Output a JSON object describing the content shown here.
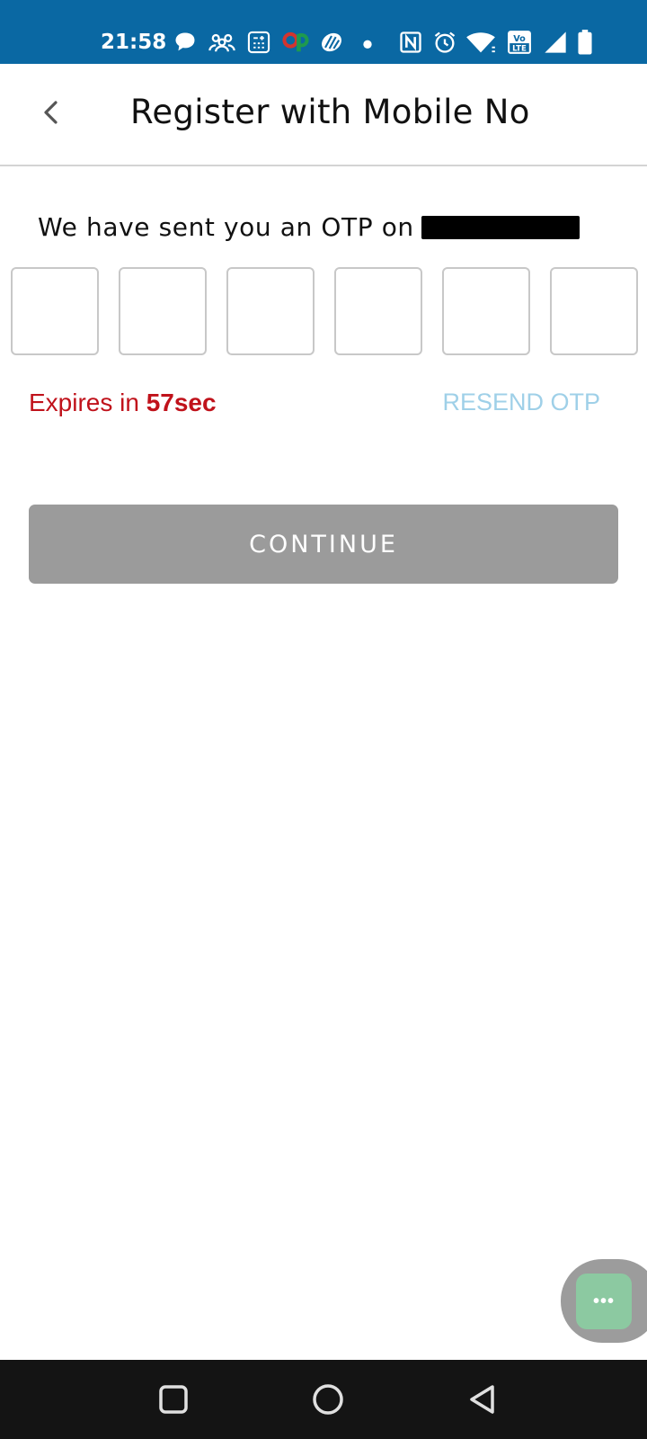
{
  "status_bar": {
    "time": "21:58",
    "icons": [
      "chat-bubble-icon",
      "people-icon",
      "calculator-icon",
      "paytm-icon",
      "app-icon",
      "dot-icon",
      "nfc-icon",
      "alarm-icon",
      "wifi-icon",
      "volte-icon",
      "signal-icon",
      "battery-icon"
    ],
    "volte_label": "LTE"
  },
  "header": {
    "back_icon": "chevron-left-icon",
    "title": "Register with Mobile No"
  },
  "otp": {
    "message": "We have sent you an OTP on",
    "phone_number_redacted": true,
    "boxes": [
      "",
      "",
      "",
      "",
      "",
      ""
    ],
    "expires_prefix": "Expires in ",
    "expires_value": "57sec",
    "resend_label": "RESEND OTP"
  },
  "actions": {
    "continue_label": "CONTINUE"
  },
  "chat_widget": {
    "icon": "more-dots-icon",
    "label": "•••"
  },
  "nav_bar": {
    "items": [
      "recents-square-icon",
      "home-circle-icon",
      "back-triangle-icon"
    ]
  },
  "colors": {
    "status_bar": "#0a68a3",
    "expires": "#c0121b",
    "resend": "#9fd0e8",
    "continue_bg": "#9b9b9b",
    "chat_button": "#8cc9a1",
    "nav_bar": "#141414"
  }
}
